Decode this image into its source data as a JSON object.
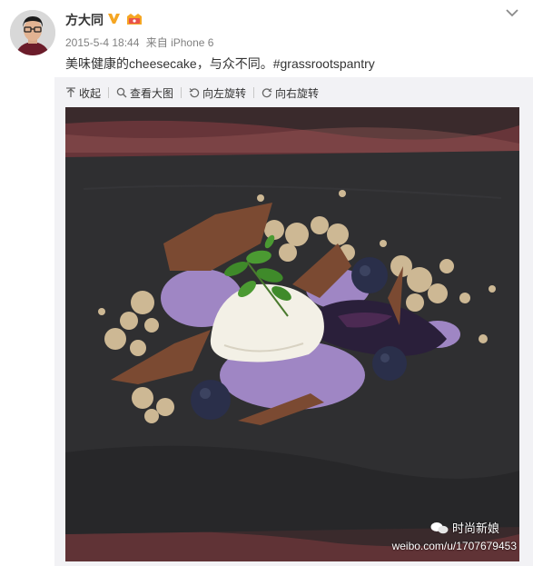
{
  "post": {
    "author": "方大同",
    "timestamp": "2015-5-4 18:44",
    "source": "来自 iPhone 6",
    "text": "美味健康的cheesecake，与众不同。#grassrootspantry"
  },
  "toolbar": {
    "collapse": "收起",
    "view_large": "查看大图",
    "rotate_left": "向左旋转",
    "rotate_right": "向右旋转"
  },
  "photo": {
    "watermark_url": "weibo.com/u/1707679453",
    "watermark_logo": "时尚新娘"
  },
  "icons": {
    "verified": "verified-v-icon",
    "vip": "vip-badge-icon",
    "menu": "chevron-down-icon"
  },
  "colors": {
    "verified_gold": "#f5a623",
    "vip_red": "#e9524b",
    "slate": "#2b2b2c",
    "cream": "#f3f0e6",
    "purple": "#9f86c4",
    "blueberry": "#2a2f4a"
  }
}
